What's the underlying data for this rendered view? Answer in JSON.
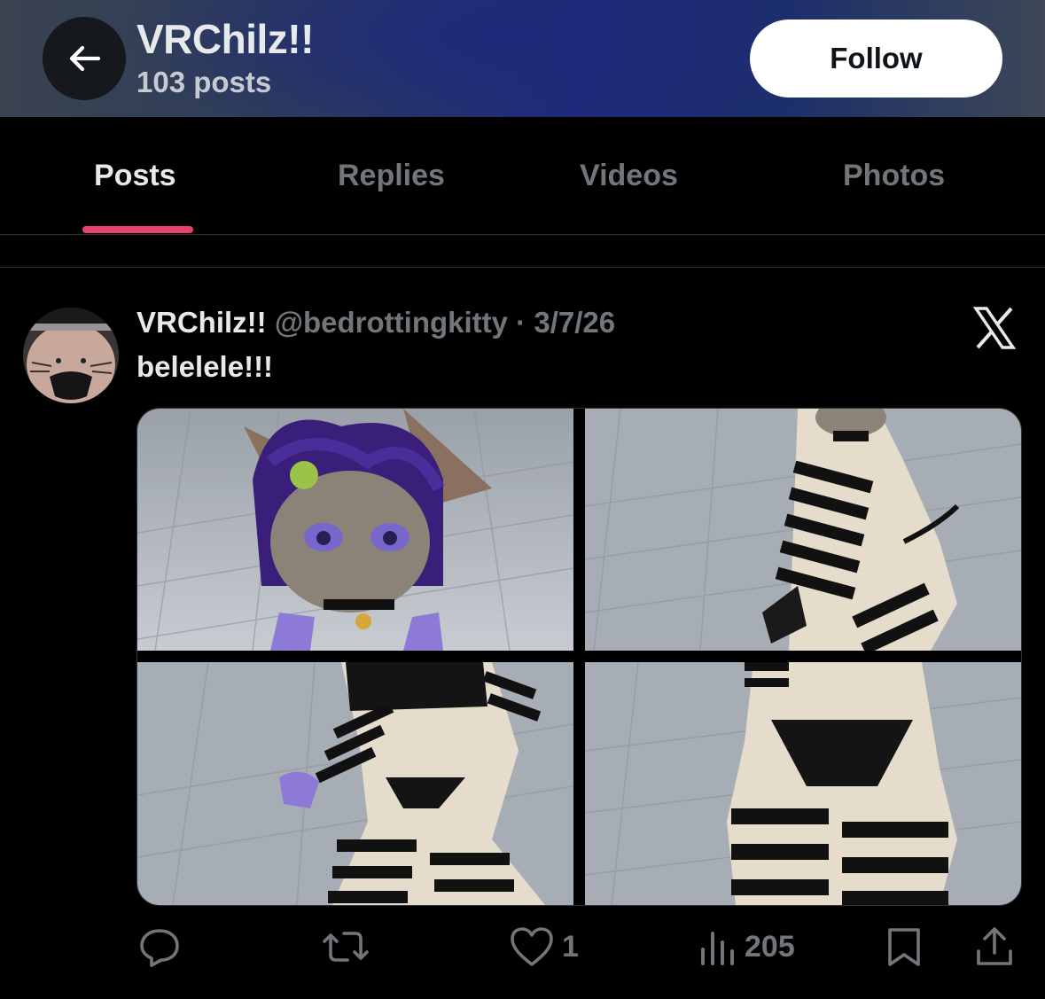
{
  "header": {
    "name": "VRChilz!!",
    "post_count": "103 posts",
    "follow_label": "Follow",
    "back_icon": "arrow-left-icon"
  },
  "tabs": [
    {
      "label": "Posts",
      "active": true
    },
    {
      "label": "Replies",
      "active": false
    },
    {
      "label": "Videos",
      "active": false
    },
    {
      "label": "Photos",
      "active": false
    }
  ],
  "post": {
    "display_name": "VRChilz!!",
    "handle": "@bedrottingkitty",
    "separator": "·",
    "date": "3/7/26",
    "text": "belelele!!!",
    "platform_icon": "x-logo-icon",
    "media_count": 4,
    "actions": {
      "reply_count": "",
      "repost_count": "",
      "like_count": "1",
      "view_count": "205"
    }
  },
  "colors": {
    "background": "#000000",
    "text_primary": "#e7e9ea",
    "text_secondary": "#71767b",
    "tab_indicator": "#e8436f",
    "follow_bg": "#ffffff"
  }
}
